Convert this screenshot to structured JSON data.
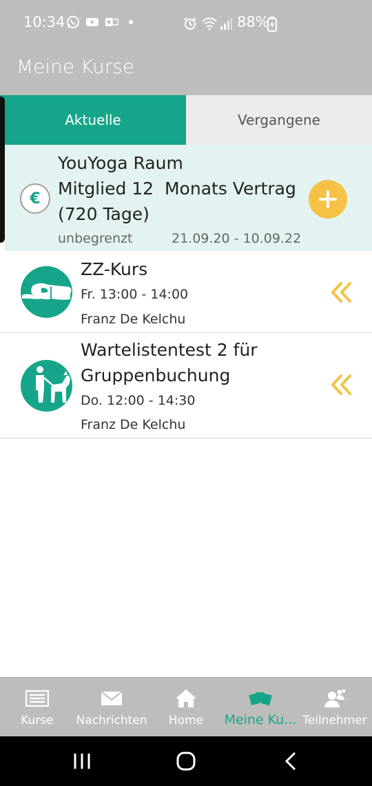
{
  "status_bar": {
    "time": "10:34",
    "battery": "88%"
  },
  "app_bar": {
    "title": "Meine Kurse"
  },
  "tabs": [
    {
      "label": "Aktuelle",
      "active": true
    },
    {
      "label": "Vergangene",
      "active": false
    }
  ],
  "membership": {
    "title_line1": "YouYoga Raum",
    "title_line2": "Mitglied 12  Monats Vertrag",
    "title_line3": "(720 Tage)",
    "limit": "unbegrenzt",
    "dates": "21.09.20 - 10.09.22",
    "icon": "euro-icon",
    "action_icon": "plus-icon"
  },
  "courses": [
    {
      "name": "ZZ-Kurs",
      "time": "Fr. 13:00 - 14:00",
      "trainer": "Franz De Kelchu",
      "icon": "massage-hand-icon"
    },
    {
      "name": "Wartelistentest 2 für Gruppenbuchung",
      "time": "Do. 12:00 - 14:30",
      "trainer": "Franz De Kelchu",
      "icon": "guide-dog-icon"
    }
  ],
  "bottom_nav": [
    {
      "label": "Kurse",
      "icon": "list-icon",
      "active": false
    },
    {
      "label": "Nachrichten",
      "icon": "mail-icon",
      "active": false
    },
    {
      "label": "Home",
      "icon": "home-icon",
      "active": false
    },
    {
      "label": "Meine Ku...",
      "icon": "cards-icon",
      "active": true
    },
    {
      "label": "Teilnehmer",
      "icon": "people-icon",
      "active": false
    }
  ],
  "colors": {
    "accent": "#16a58a",
    "bar_grey": "#bdbdbd",
    "membership_bg": "#e3f3f2",
    "action_yellow": "#f6c245"
  }
}
